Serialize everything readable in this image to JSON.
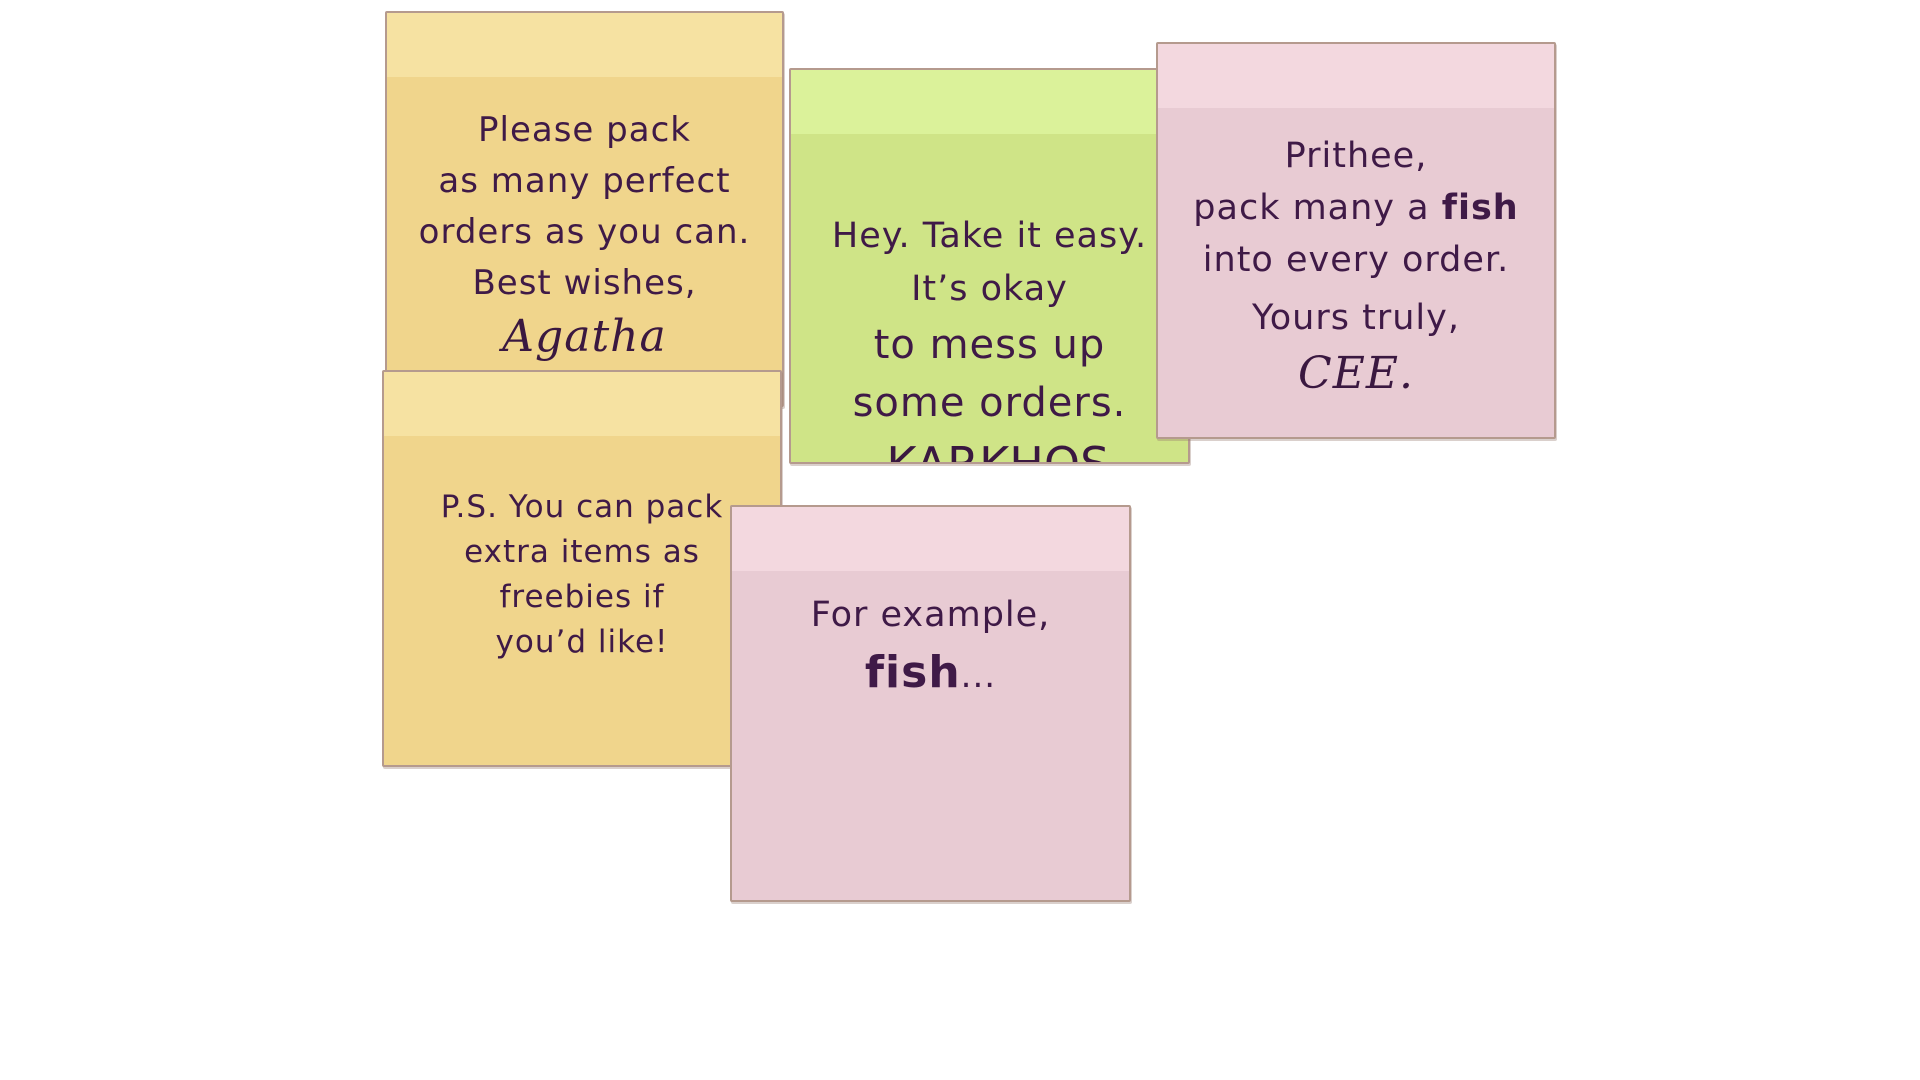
{
  "notes": {
    "agatha": {
      "lines": [
        "Please pack",
        "as many perfect",
        "orders as you can.",
        "Best wishes,"
      ],
      "signature": "Agatha",
      "color": "#f0d58c"
    },
    "karkhos": {
      "lines": [
        "Hey. Take it easy.",
        "It’s okay",
        "to mess up",
        "some orders."
      ],
      "signature": "-KARKHOS",
      "color": "#cfe487"
    },
    "cee": {
      "line1": "Prithee,",
      "line2_pre": "pack many a ",
      "line2_bold": "fish",
      "line3": "into every order.",
      "line4": "Yours truly,",
      "signature": "CEE.",
      "color": "#e8cbd3"
    },
    "ps": {
      "lines": [
        "P.S. You can pack",
        "extra items as",
        "freebies if",
        "you’d like!"
      ],
      "color": "#f0d58c"
    },
    "example": {
      "line1": "For example,",
      "fish_bold": "fish",
      "fish_tail": "...",
      "color": "#e8cbd3"
    }
  },
  "colors": {
    "text": "#3f1a47",
    "border": "#b59a8e",
    "background": "#ffffff"
  }
}
